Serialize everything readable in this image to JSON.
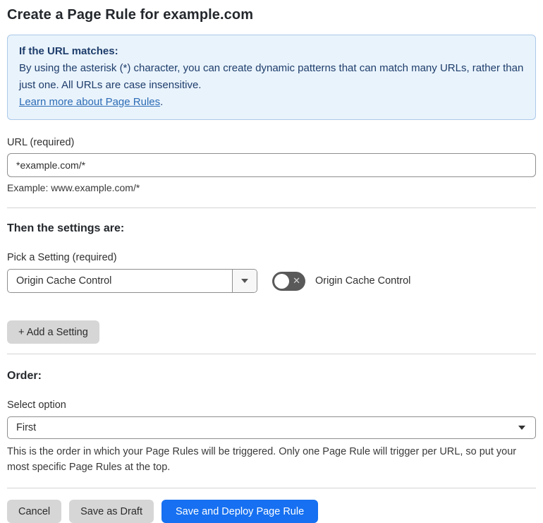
{
  "page": {
    "title": "Create a Page Rule for example.com"
  },
  "banner": {
    "heading": "If the URL matches:",
    "body": "By using the asterisk (*) character, you can create dynamic patterns that can match many URLs, rather than just one. All URLs are case insensitive.",
    "link": "Learn more about Page Rules",
    "link_suffix": ".",
    "colors": {
      "background": "#e9f3fc",
      "border": "#abc9e9",
      "text": "#1e3d6b",
      "link": "#2c6cb5"
    }
  },
  "url_section": {
    "label": "URL (required)",
    "value": "*example.com/*",
    "helper": "Example: www.example.com/*"
  },
  "settings_section": {
    "heading": "Then the settings are:",
    "picker_label": "Pick a Setting (required)",
    "picker_value": "Origin Cache Control",
    "toggle_label": "Origin Cache Control",
    "toggle_state": "off",
    "toggle_x_glyph": "✕",
    "add_button_label": "+ Add a Setting"
  },
  "order_section": {
    "heading": "Order:",
    "select_label": "Select option",
    "select_value": "First",
    "helper": "This is the order in which your Page Rules will be triggered. Only one Page Rule will trigger per URL, so put your most specific Page Rules at the top."
  },
  "footer": {
    "cancel_label": "Cancel",
    "save_draft_label": "Save as Draft",
    "save_deploy_label": "Save and Deploy Page Rule",
    "primary_color": "#1670f1"
  }
}
